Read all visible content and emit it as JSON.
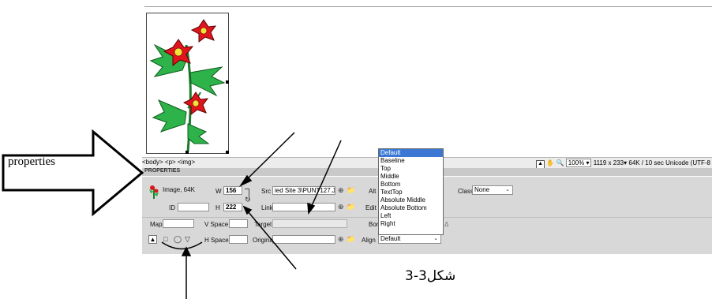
{
  "annotations": {
    "callout_label": "properties",
    "figure_caption": "شكل3-3"
  },
  "status_bar": {
    "tag_selector": "<body> <p> <img>",
    "zoom": "100%",
    "dimensions": "1119 x 233",
    "size_time": "64K / 10 sec",
    "encoding": "Unicode (UTF-8"
  },
  "panel": {
    "title": "PROPERTIES",
    "image_info": "Image, 64K",
    "id_label": "ID",
    "id_value": "",
    "w_label": "W",
    "w_value": "156",
    "h_label": "H",
    "h_value": "222",
    "src_label": "Src",
    "src_value": "ied Site 3\\PUNT127.JPG",
    "link_label": "Link",
    "link_value": "",
    "alt_label": "Alt",
    "edit_label": "Edit",
    "class_label": "Class",
    "class_value": "None",
    "map_label": "Map",
    "map_value": "",
    "vspace_label": "V Space",
    "vspace_value": "",
    "hspace_label": "H Space",
    "hspace_value": "",
    "target_label": "Target",
    "target_value": "",
    "original_label": "Original",
    "original_value": "",
    "border_label": "Border",
    "align_label": "Align",
    "align_value": "Default"
  },
  "align_options": [
    "Default",
    "Baseline",
    "Top",
    "Middle",
    "Bottom",
    "TextTop",
    "Absolute Middle",
    "Absolute Bottom",
    "Left",
    "Right"
  ],
  "colors": {
    "highlight": "#3a78d4",
    "panel": "#d8d8d8",
    "flower_red": "#e0141c",
    "leaf_green": "#2db34a"
  }
}
